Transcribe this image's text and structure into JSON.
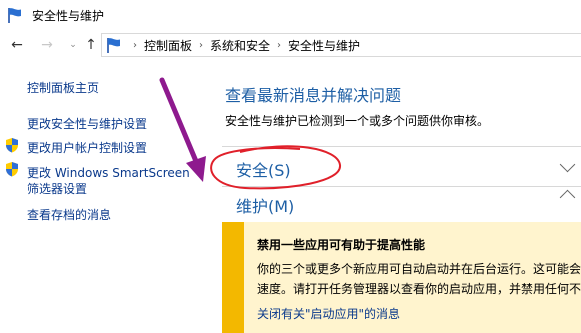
{
  "window": {
    "title": "安全性与维护",
    "icon": "flag-icon"
  },
  "navigation": {
    "back": "←",
    "forward": "→",
    "recent": "⌄",
    "up": "↑",
    "breadcrumb": [
      "控制面板",
      "系统和安全",
      "安全性与维护"
    ],
    "separator": "›"
  },
  "sidebar": {
    "home": "控制面板主页",
    "change_settings": "更改安全性与维护设置",
    "change_uac": "更改用户帐户控制设置",
    "change_smartscreen_line1": "更改 Windows SmartScreen",
    "change_smartscreen_line2": "筛选器设置",
    "view_archived": "查看存档的消息"
  },
  "main": {
    "title": "查看最新消息并解决问题",
    "description": "安全性与维护已检测到一个或多个问题供你审核。",
    "sections": [
      {
        "label": "安全(S)"
      },
      {
        "label": "维护(M)"
      }
    ]
  },
  "notice": {
    "title": "禁用一些应用可有助于提高性能",
    "body_line1": "你的三个或更多个新应用可自动启动并在后台运行。这可能会",
    "body_line2": "速度。请打开任务管理器以查看你的启动应用，并禁用任何不",
    "link": "关闭有关\"启动应用\"的消息"
  },
  "colors": {
    "link": "#0b3a8c",
    "heading": "#1e5fa5",
    "notice_bg": "#fff4ce",
    "notice_stripe": "#f3b800",
    "annotation_arrow": "#8e1a8e",
    "annotation_circle": "#e0202a"
  }
}
